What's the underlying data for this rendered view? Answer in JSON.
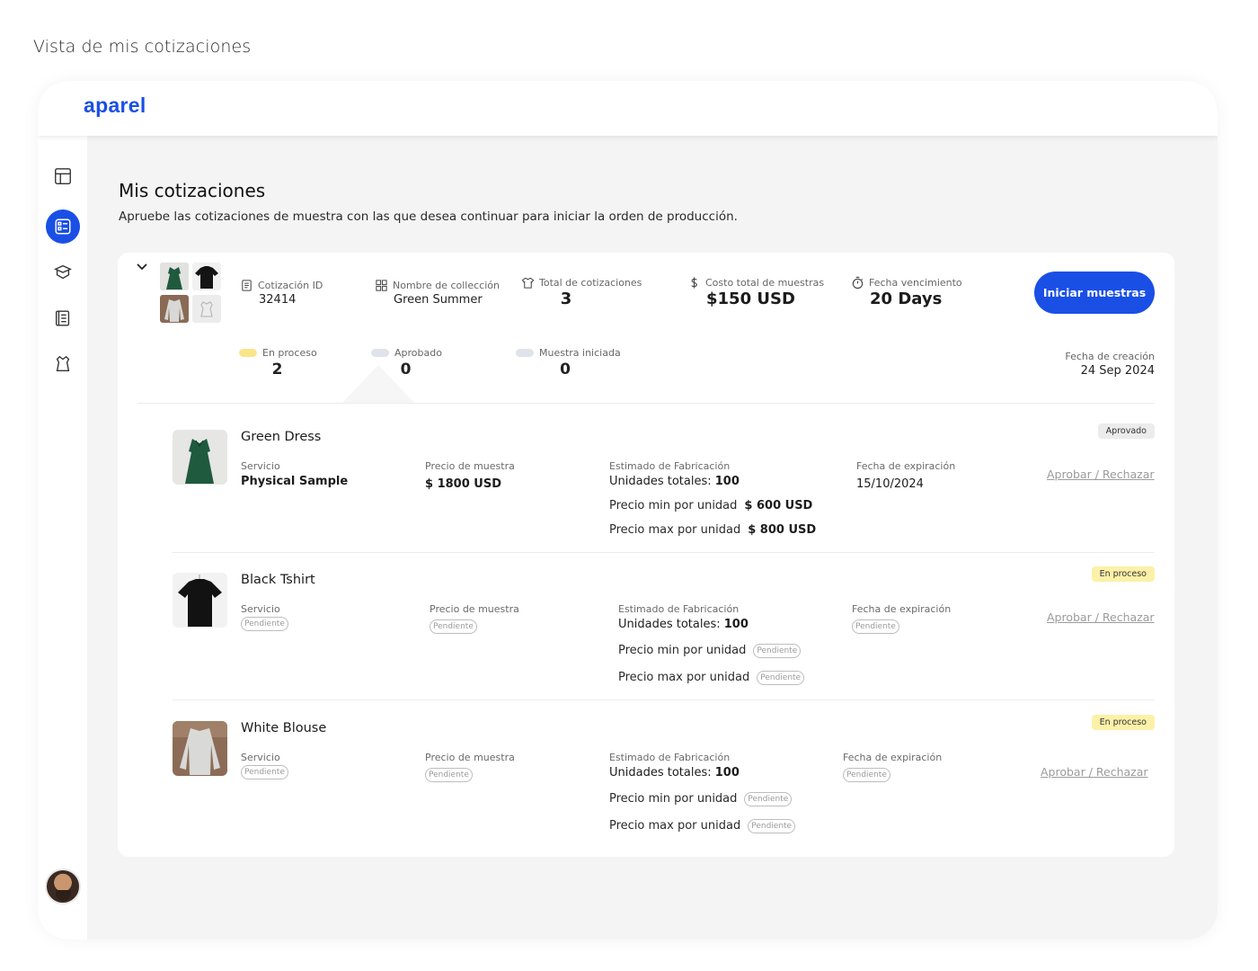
{
  "caption": "Vista de mis cotizaciones",
  "app": {
    "logo": "aparel"
  },
  "sidebar": {
    "items": [
      {
        "icon": "layout-icon",
        "active": false
      },
      {
        "icon": "quotes-list-icon",
        "active": true
      },
      {
        "icon": "box-icon",
        "active": false
      },
      {
        "icon": "catalog-icon",
        "active": false
      },
      {
        "icon": "garment-icon",
        "active": false
      }
    ]
  },
  "page": {
    "title": "Mis cotizaciones",
    "subtitle": "Apruebe las cotizaciones de muestra con las que desea continuar para iniciar la orden de producción."
  },
  "quote": {
    "id_label": "Cotización ID",
    "id_value": "32414",
    "collection_label": "Nombre de collección",
    "collection_value": "Green Summer",
    "total_label": "Total de cotizaciones",
    "total_value": "3",
    "cost_label": "Costo total de muestras",
    "cost_value": "$150 USD",
    "due_label": "Fecha vencimiento",
    "due_value": "20 Days",
    "start_button": "Iniciar muestras",
    "status": [
      {
        "label": "En proceso",
        "count": "2",
        "color": "#fbe58a"
      },
      {
        "label": "Aprobado",
        "count": "0",
        "color": "#dfe3ea"
      },
      {
        "label": "Muestra iniciada",
        "count": "0",
        "color": "#dfe3ea"
      }
    ],
    "creation_label": "Fecha de creación",
    "creation_value": "24 Sep 2024"
  },
  "labels": {
    "service": "Servicio",
    "sample_price": "Precio de muestra",
    "estimate": "Estimado de Fabricación",
    "units": "Unidades totales:",
    "min_price": "Precio min por unidad",
    "max_price": "Precio max por unidad",
    "expiration": "Fecha de expiración",
    "action": "Aprobar / Rechazar",
    "pending": "Pendiente"
  },
  "items": [
    {
      "name": "Green Dress",
      "service": "Physical Sample",
      "sample_price": "$ 1800 USD",
      "units": "100",
      "min_price": "$ 600 USD",
      "max_price": "$ 800 USD",
      "expiration": "15/10/2024",
      "badge": "Aprovado",
      "badge_color": "#ececec"
    },
    {
      "name": "Black Tshirt",
      "units": "100",
      "badge": "En proceso",
      "badge_color": "#fdf0a8"
    },
    {
      "name": "White Blouse",
      "units": "100",
      "badge": "En proceso",
      "badge_color": "#fdf0a8"
    }
  ]
}
